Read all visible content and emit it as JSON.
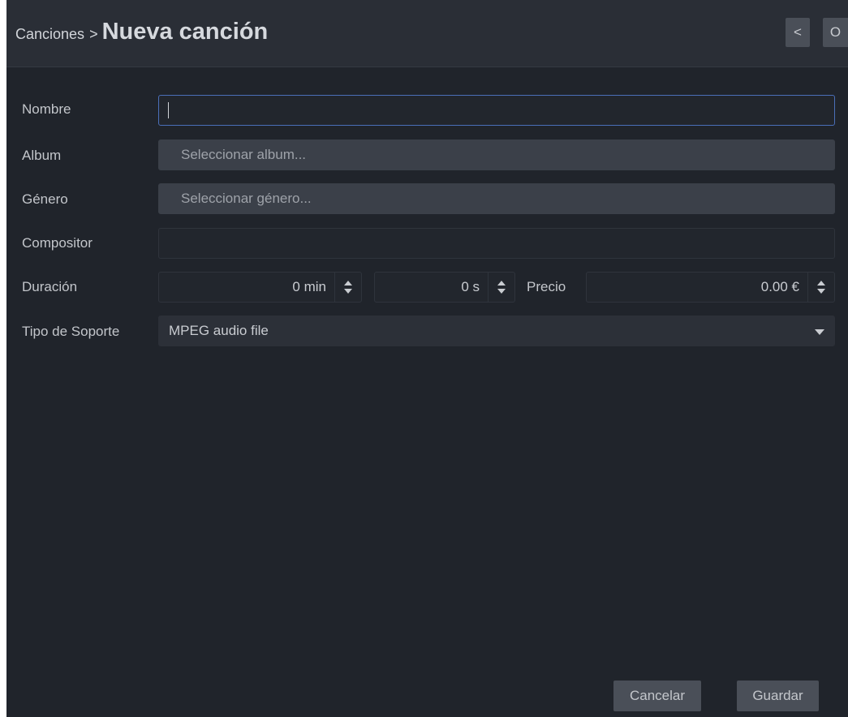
{
  "header": {
    "breadcrumb_parent": "Canciones",
    "breadcrumb_separator": ">",
    "title": "Nueva canción",
    "prev_button": "<",
    "other_button": "O"
  },
  "form": {
    "nombre": {
      "label": "Nombre",
      "value": ""
    },
    "album": {
      "label": "Album",
      "placeholder": "Seleccionar album..."
    },
    "genero": {
      "label": "Género",
      "placeholder": "Seleccionar género..."
    },
    "compositor": {
      "label": "Compositor",
      "value": ""
    },
    "duracion": {
      "label": "Duración",
      "minutes": "0 min",
      "seconds": "0 s"
    },
    "precio": {
      "label": "Precio",
      "value": "0.00 €"
    },
    "tipo_soporte": {
      "label": "Tipo de Soporte",
      "selected": "MPEG audio file"
    }
  },
  "footer": {
    "cancel_label": "Cancelar",
    "save_label": "Guardar"
  },
  "colors": {
    "background": "#20242b",
    "header": "#2a2e36",
    "focus_border": "#4a6fb8",
    "button": "#4a4f58"
  },
  "icons": {
    "spinner": "sort-up-down-icon",
    "dropdown": "caret-down-icon"
  }
}
